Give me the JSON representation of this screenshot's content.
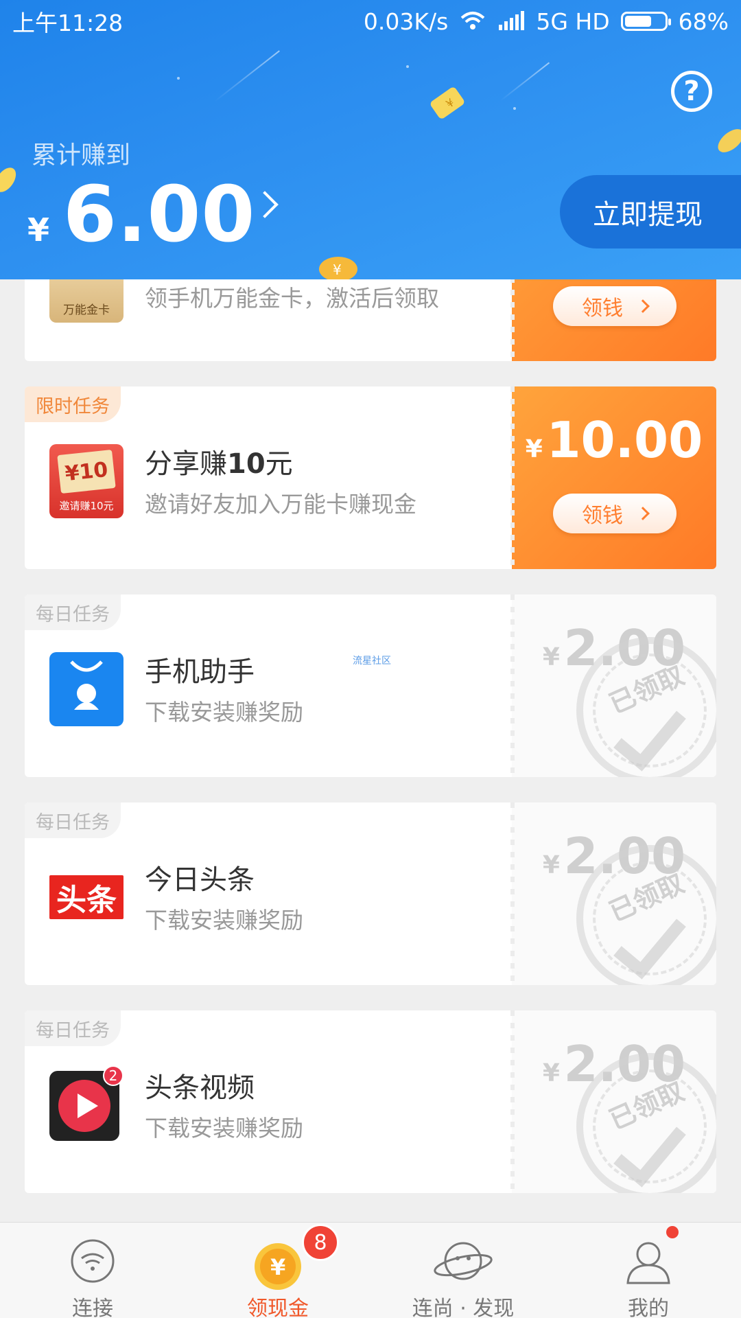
{
  "status_bar": {
    "time": "上午11:28",
    "speed": "0.03K/s",
    "network": "5G HD",
    "battery": "68%"
  },
  "header": {
    "earned_label": "累计赚到",
    "currency": "¥",
    "earned_amount": "6.00",
    "withdraw_label": "立即提现",
    "help": "?"
  },
  "tasks": [
    {
      "icon_text": "万能金卡",
      "desc": "领手机万能金卡，激活后领取",
      "claim_label": "领钱"
    },
    {
      "tag": "限时任务",
      "title_prefix": "分享赚",
      "title_bold": "10",
      "title_suffix": "元",
      "desc": "邀请好友加入万能卡赚现金",
      "icon_big": "¥10",
      "icon_caption": "邀请赚10元",
      "currency": "¥",
      "amount": "10.00",
      "claim_label": "领钱"
    },
    {
      "tag": "每日任务",
      "title": "手机助手",
      "desc": "下载安装赚奖励",
      "currency": "¥",
      "amount": "2.00",
      "stamp": "已领取"
    },
    {
      "tag": "每日任务",
      "title": "今日头条",
      "desc": "下载安装赚奖励",
      "icon_text": "头条",
      "currency": "¥",
      "amount": "2.00",
      "stamp": "已领取"
    },
    {
      "tag": "每日任务",
      "title": "头条视频",
      "desc": "下载安装赚奖励",
      "icon_badge": "2",
      "currency": "¥",
      "amount": "2.00",
      "stamp": "已领取"
    }
  ],
  "watermark": "流星社区",
  "bottom_nav": {
    "items": [
      {
        "label": "连接",
        "icon": "wifi-icon"
      },
      {
        "label": "领现金",
        "icon": "coin-icon",
        "active": true
      },
      {
        "label": "连尚 · 发现",
        "icon": "planet-icon"
      },
      {
        "label": "我的",
        "icon": "user-icon"
      }
    ],
    "cash_badge": "8",
    "coin_symbol": "¥"
  },
  "colors": {
    "header_blue": "#2d8ff0",
    "accent_orange": "#ff7a27",
    "active_tab": "#f0582a",
    "badge_red": "#f04336"
  }
}
